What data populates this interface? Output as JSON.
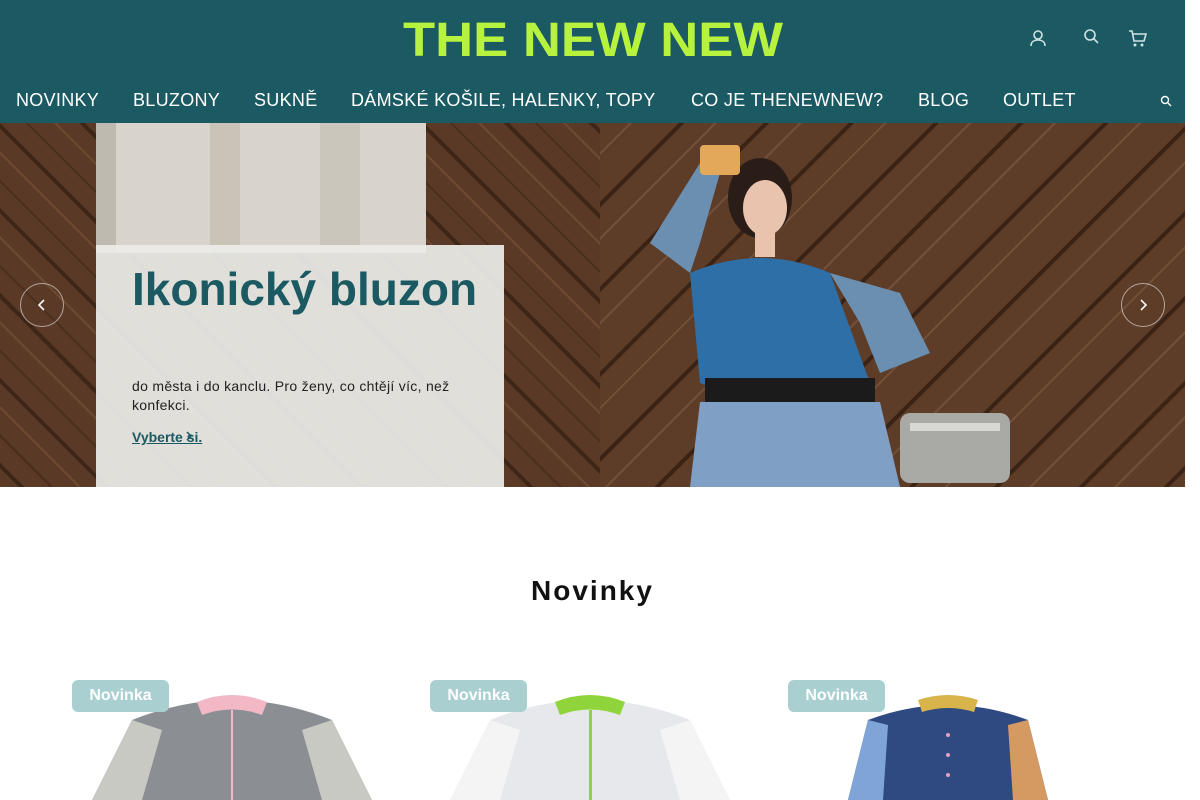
{
  "brand": {
    "logo_text": "THE NEW NEW",
    "header_color": "#1b5a62",
    "logo_color": "#b6f23e"
  },
  "header_icons": [
    "user-icon",
    "search-icon",
    "cart-icon"
  ],
  "nav": {
    "items": [
      {
        "label": "NOVINKY"
      },
      {
        "label": "BLUZONY"
      },
      {
        "label": "SUKNĚ"
      },
      {
        "label": "DÁMSKÉ KOŠILE, HALENKY, TOPY"
      },
      {
        "label": "CO JE THENEWNEW?"
      },
      {
        "label": "BLOG"
      },
      {
        "label": "OUTLET"
      }
    ]
  },
  "hero": {
    "title": "Ikonický bluzon",
    "text": "do města i do kanclu. Pro ženy, co chtějí víc, než konfekci.",
    "cta": "Vyberte si."
  },
  "section": {
    "title": "Novinky"
  },
  "products": [
    {
      "badge": "Novinka",
      "collar_color": "#f2b8c6"
    },
    {
      "badge": "Novinka",
      "collar_color": "#8fd43a"
    },
    {
      "badge": "Novinka",
      "collar_color": "#d9b44a"
    }
  ]
}
